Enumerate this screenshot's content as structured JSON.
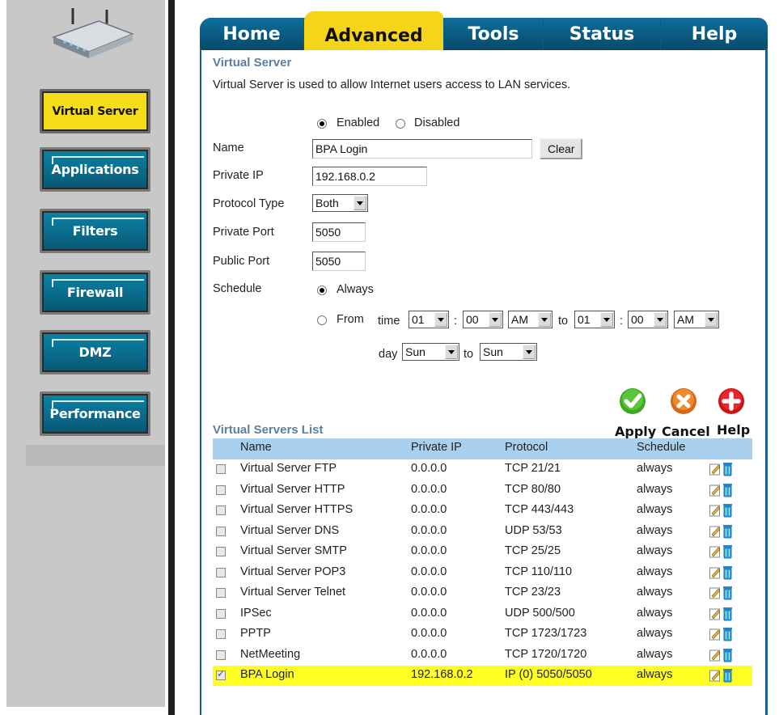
{
  "tabs": [
    {
      "label": "Home"
    },
    {
      "label": "Advanced"
    },
    {
      "label": "Tools"
    },
    {
      "label": "Status"
    },
    {
      "label": "Help"
    }
  ],
  "sidebar": {
    "items": [
      {
        "label": "Virtual Server",
        "active": true
      },
      {
        "label": "Applications"
      },
      {
        "label": "Filters"
      },
      {
        "label": "Firewall"
      },
      {
        "label": "DMZ"
      },
      {
        "label": "Performance"
      }
    ]
  },
  "section": {
    "title": "Virtual Server",
    "description": "Virtual Server is used to allow Internet users access to LAN services."
  },
  "form": {
    "enabled_label": "Enabled",
    "disabled_label": "Disabled",
    "name_label": "Name",
    "name_value": "BPA Login",
    "clear_label": "Clear",
    "private_ip_label": "Private IP",
    "private_ip_value": "192.168.0.2",
    "protocol_label": "Protocol Type",
    "protocol_value": "Both",
    "private_port_label": "Private Port",
    "private_port_value": "5050",
    "public_port_label": "Public Port",
    "public_port_value": "5050",
    "schedule_label": "Schedule",
    "always_label": "Always",
    "from_label": "From",
    "time_label": "time",
    "colon1": ":",
    "colon2": ":",
    "to_label": "to",
    "day_label": "day",
    "day_to_label": "to",
    "from_hour": "01",
    "from_min": "00",
    "from_ampm": "AM",
    "to_hour": "01",
    "to_min": "00",
    "to_ampm": "AM",
    "day_from": "Sun",
    "day_to": "Sun"
  },
  "actions": {
    "apply": "Apply",
    "cancel": "Cancel",
    "help": "Help"
  },
  "list": {
    "title": "Virtual Servers List",
    "columns": [
      "Name",
      "Private IP",
      "Protocol",
      "Schedule"
    ],
    "rows": [
      {
        "name": "Virtual Server FTP",
        "ip": "0.0.0.0",
        "protocol": "TCP 21/21",
        "schedule": "always"
      },
      {
        "name": "Virtual Server HTTP",
        "ip": "0.0.0.0",
        "protocol": "TCP 80/80",
        "schedule": "always"
      },
      {
        "name": "Virtual Server HTTPS",
        "ip": "0.0.0.0",
        "protocol": "TCP 443/443",
        "schedule": "always"
      },
      {
        "name": "Virtual Server DNS",
        "ip": "0.0.0.0",
        "protocol": "UDP 53/53",
        "schedule": "always"
      },
      {
        "name": "Virtual Server SMTP",
        "ip": "0.0.0.0",
        "protocol": "TCP 25/25",
        "schedule": "always"
      },
      {
        "name": "Virtual Server POP3",
        "ip": "0.0.0.0",
        "protocol": "TCP 110/110",
        "schedule": "always"
      },
      {
        "name": "Virtual Server Telnet",
        "ip": "0.0.0.0",
        "protocol": "TCP 23/23",
        "schedule": "always"
      },
      {
        "name": "IPSec",
        "ip": "0.0.0.0",
        "protocol": "UDP 500/500",
        "schedule": "always"
      },
      {
        "name": "PPTP",
        "ip": "0.0.0.0",
        "protocol": "TCP 1723/1723",
        "schedule": "always"
      },
      {
        "name": "NetMeeting",
        "ip": "0.0.0.0",
        "protocol": "TCP 1720/1720",
        "schedule": "always"
      },
      {
        "name": "BPA Login",
        "ip": "192.168.0.2",
        "protocol": "IP (0) 5050/5050",
        "schedule": "always",
        "checked": true
      }
    ]
  }
}
